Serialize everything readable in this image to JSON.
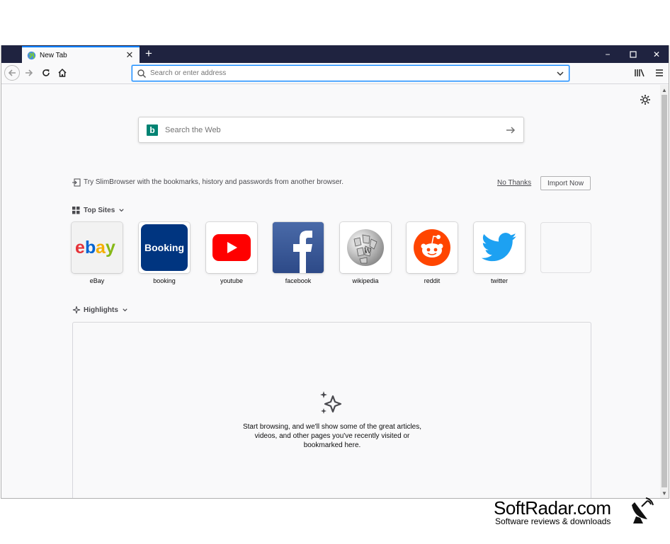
{
  "browser": {
    "tab": {
      "title": "New Tab"
    },
    "new_tab_symbol": "+",
    "window_controls": {
      "minimize": "−",
      "maximize": "☐",
      "close": "✕"
    },
    "urlbar": {
      "placeholder": "Search or enter address"
    }
  },
  "newtab": {
    "web_search": {
      "placeholder": "Search the Web",
      "engine_icon": "bing-icon"
    },
    "import_prompt": {
      "text": "Try SlimBrowser with the bookmarks, history and passwords from another browser.",
      "dismiss_label": "No Thanks",
      "import_label": "Import Now"
    },
    "top_sites": {
      "title": "Top Sites",
      "sites": [
        {
          "label": "eBay",
          "icon": "ebay-logo"
        },
        {
          "label": "booking",
          "icon": "booking-logo"
        },
        {
          "label": "youtube",
          "icon": "youtube-logo"
        },
        {
          "label": "facebook",
          "icon": "facebook-logo"
        },
        {
          "label": "wikipedia",
          "icon": "wikipedia-logo"
        },
        {
          "label": "reddit",
          "icon": "reddit-logo"
        },
        {
          "label": "twitter",
          "icon": "twitter-logo"
        }
      ]
    },
    "highlights": {
      "title": "Highlights",
      "empty_message": "Start browsing, and we'll show some of the great articles, videos, and other pages you've recently visited or bookmarked here."
    }
  },
  "watermark": {
    "name": "SoftRadar.com",
    "tagline": "Software reviews & downloads"
  },
  "colors": {
    "tabbar": "#1f2340",
    "accent": "#0a84ff",
    "bing": "#008373",
    "booking": "#003580",
    "youtube": "#ff0000",
    "facebook": "#3b5998",
    "reddit": "#ff4500",
    "twitter": "#1da1f2"
  }
}
